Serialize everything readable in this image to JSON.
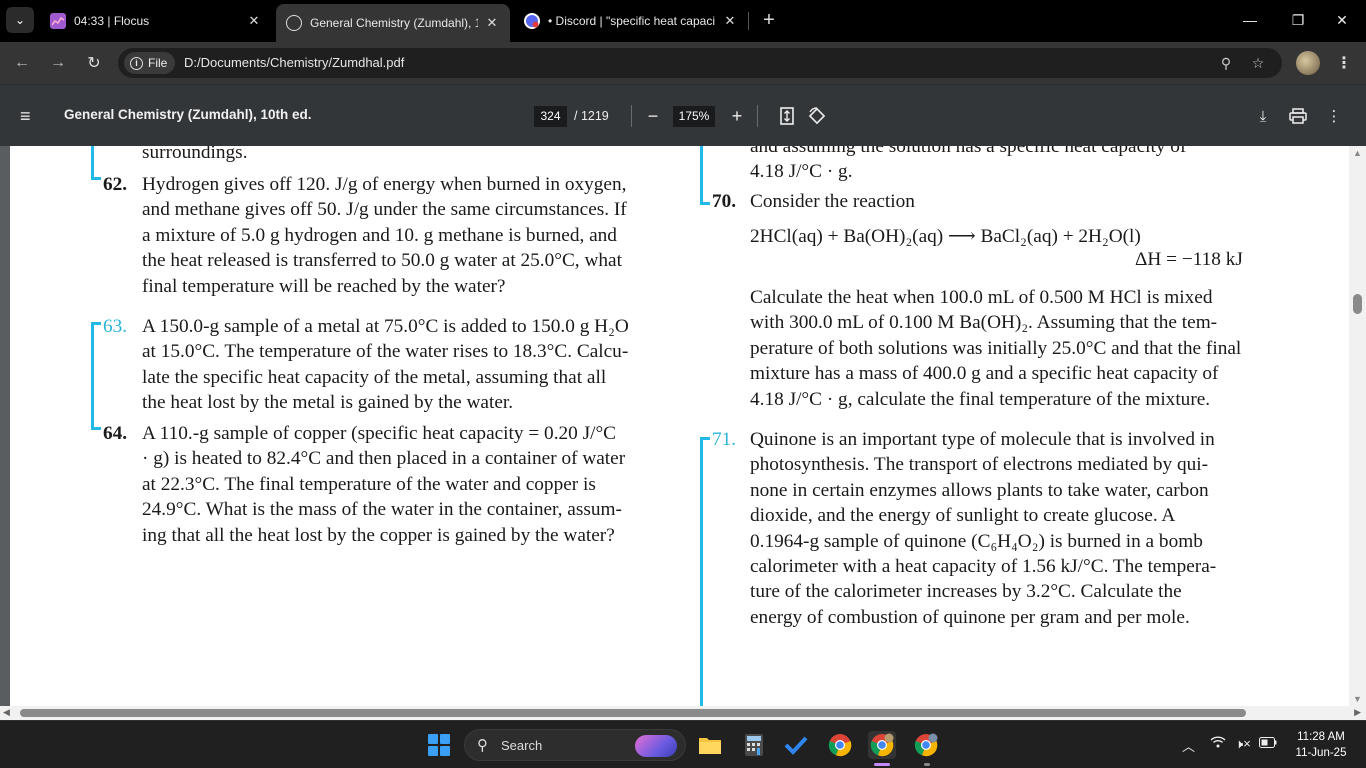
{
  "tabs": [
    {
      "title": "04:33 | Flocus",
      "active": false
    },
    {
      "title": "General Chemistry (Zumdahl), 1",
      "active": true
    },
    {
      "title": "• Discord | \"specific heat capaci",
      "active": false
    }
  ],
  "address": {
    "chip_label": "File",
    "url": "D:/Documents/Chemistry/Zumdhal.pdf"
  },
  "pdf_toolbar": {
    "title": "General Chemistry (Zumdahl), 10th ed.",
    "page_current": "324",
    "page_total": "/ 1219",
    "zoom": "175%"
  },
  "page_content": {
    "left_top_fragment": "surroundings.",
    "q62": {
      "number": "62.",
      "lines": [
        "Hydrogen gives off 120. J/g of energy when burned in oxygen,",
        "and methane gives off 50. J/g under the same circumstances. If",
        "a mixture of 5.0 g hydrogen and 10. g methane is burned, and",
        "the heat released is transferred to 50.0 g water at 25.0°C, what",
        "final temperature will be reached by the water?"
      ]
    },
    "q63": {
      "number": "63.",
      "lines": [
        "A 150.0-g sample of a metal at 75.0°C is added to 150.0 g H₂O",
        "at 15.0°C. The temperature of the water rises to 18.3°C. Calcu-",
        "late the specific heat capacity of the metal, assuming that all",
        "the heat lost by the metal is gained by the water."
      ]
    },
    "q64": {
      "number": "64.",
      "lines": [
        "A 110.-g sample of copper (specific heat capacity = 0.20 J/°C",
        "· g) is heated to 82.4°C and then placed in a container of water",
        "at 22.3°C. The final temperature of the water and copper is",
        "24.9°C. What is the mass of the water in the container, assum-",
        "ing that all the heat lost by the copper is gained by the water?"
      ]
    },
    "right_top_fragment": [
      "and assuming the solution has a specific heat capacity of",
      "4.18 J/°C · g."
    ],
    "q70": {
      "number": "70.",
      "intro": "Consider the reaction",
      "equation": "2HCl(aq) + Ba(OH)₂(aq) ⟶ BaCl₂(aq) + 2H₂O(l)",
      "delta_h": "ΔH = −118 kJ",
      "lines": [
        "Calculate the heat when 100.0 mL of 0.500 M HCl is mixed",
        "with 300.0 mL of 0.100 M Ba(OH)₂. Assuming that the tem-",
        "perature of both solutions was initially 25.0°C and that the final",
        "mixture has a mass of 400.0 g and a specific heat capacity of",
        "4.18 J/°C · g, calculate the final temperature of the mixture."
      ]
    },
    "q71": {
      "number": "71.",
      "lines": [
        "Quinone is an important type of molecule that is involved in",
        "photosynthesis. The transport of electrons mediated by qui-",
        "none in certain enzymes allows plants to take water, carbon",
        "dioxide, and the energy of sunlight to create glucose. A",
        "0.1964-g sample of quinone (C₆H₄O₂) is burned in a bomb",
        "calorimeter with a heat capacity of 1.56 kJ/°C. The tempera-",
        "ture of the calorimeter increases by 3.2°C. Calculate the",
        "energy of combustion of quinone per gram and per mole."
      ]
    }
  },
  "taskbar": {
    "search_label": "Search",
    "time": "11:28 AM",
    "date": "11-Jun-25"
  },
  "colors": {
    "accent_bar": "#22b8e8",
    "question_blue": "#2ab3d8",
    "pdf_toolbar": "#323639"
  }
}
